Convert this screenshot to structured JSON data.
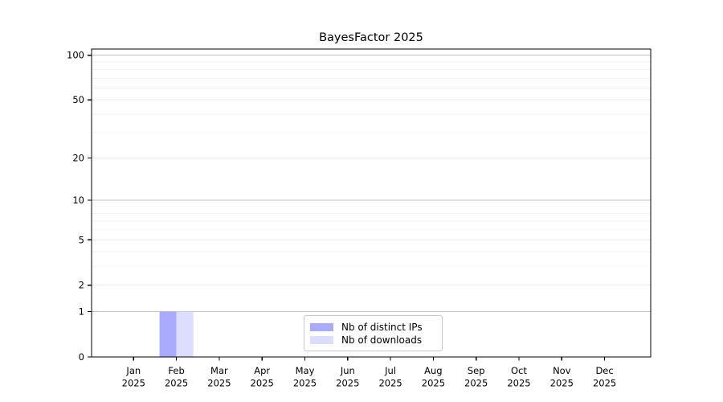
{
  "page": {
    "background_color": "#ffffff"
  },
  "chart_data": {
    "type": "bar",
    "title": "BayesFactor 2025",
    "categories": [
      "Jan",
      "Feb",
      "Mar",
      "Apr",
      "May",
      "Jun",
      "Jul",
      "Aug",
      "Sep",
      "Oct",
      "Nov",
      "Dec"
    ],
    "x_year_label": "2025",
    "series": [
      {
        "name": "Nb of distinct IPs",
        "color": "#aaaaff",
        "values": [
          0,
          1,
          0,
          0,
          0,
          0,
          0,
          0,
          0,
          0,
          0,
          0
        ]
      },
      {
        "name": "Nb of downloads",
        "color": "#ddddff",
        "values": [
          0,
          1,
          0,
          0,
          0,
          0,
          0,
          0,
          0,
          0,
          0,
          0
        ]
      }
    ],
    "xlabel": "",
    "ylabel": "",
    "yscale": "log1p",
    "ylim": [
      0,
      110
    ],
    "yticks": [
      0,
      1,
      2,
      5,
      10,
      20,
      50,
      100
    ],
    "decade_gridlines": [
      1,
      10,
      100
    ],
    "minor_gridlines": [
      3,
      4,
      6,
      7,
      8,
      9,
      30,
      40,
      60,
      70,
      80,
      90
    ],
    "grid": true,
    "legend_position": "lower center",
    "colors": {
      "spine": "#000000",
      "grid_decade": "#c2c2c2",
      "grid_labeled": "#eaeaea",
      "grid_minor": "#f2f2f2",
      "text": "#000000"
    }
  }
}
